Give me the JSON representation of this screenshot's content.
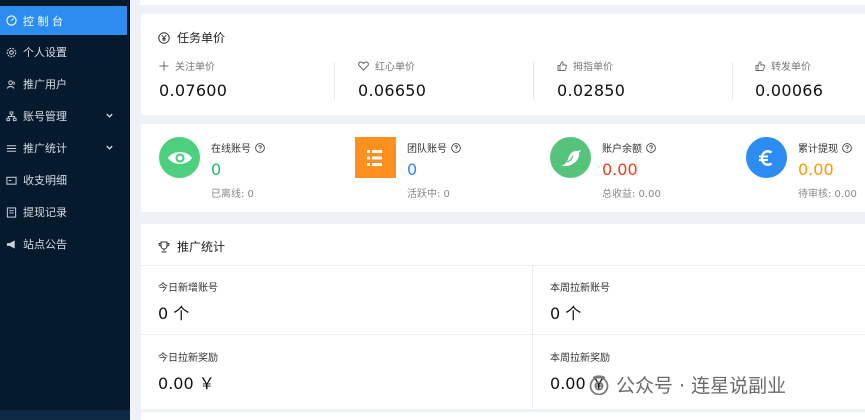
{
  "sidebar": {
    "items": [
      {
        "label": "控 制 台",
        "icon": "dashboard-icon"
      },
      {
        "label": "个人设置",
        "icon": "gear-icon"
      },
      {
        "label": "推广用户",
        "icon": "users-icon"
      },
      {
        "label": "账号管理",
        "icon": "sitemap-icon"
      },
      {
        "label": "推广统计",
        "icon": "list-icon"
      },
      {
        "label": "收支明细",
        "icon": "wallet-icon"
      },
      {
        "label": "提现记录",
        "icon": "document-icon"
      },
      {
        "label": "站点公告",
        "icon": "megaphone-icon"
      }
    ]
  },
  "price_card": {
    "title": "任务单价",
    "items": [
      {
        "label": "关注单价",
        "value": "0.07600",
        "icon": "plus-icon"
      },
      {
        "label": "红心单价",
        "value": "0.06650",
        "icon": "heart-icon"
      },
      {
        "label": "拇指单价",
        "value": "0.02850",
        "icon": "thumbs-up-icon"
      },
      {
        "label": "转发单价",
        "value": "0.00066",
        "icon": "thumbs-up-icon"
      }
    ]
  },
  "stats": [
    {
      "label": "在线账号",
      "value": "0",
      "sub": "已离线: 0",
      "color": "#19be6b",
      "icon": "eye-icon"
    },
    {
      "label": "团队账号",
      "value": "0",
      "sub": "活跃中: 0",
      "color": "#ff9900",
      "icon": "list-icon"
    },
    {
      "label": "账户余额",
      "value": "0.00",
      "sub": "总收益: 0.00",
      "color": "#ed4014",
      "icon": "bird-icon"
    },
    {
      "label": "累计提现",
      "value": "0.00",
      "sub": "待审核: 0.00",
      "color": "#ff9900",
      "icon": "euro-icon"
    }
  ],
  "stat_badge_colors": [
    "#4cd07d",
    "#ff8f1f",
    "#55c47a",
    "#2d8cf0"
  ],
  "stat_value_colors": [
    "#19be6b",
    "#2d8cf0",
    "#ed4014",
    "#ff9900"
  ],
  "promo_card": {
    "title": "推广统计",
    "cells": [
      {
        "label": "今日新增账号",
        "value": "0 个"
      },
      {
        "label": "本周拉新账号",
        "value": "0 个"
      },
      {
        "label": "今日拉新奖励",
        "value": "0.00 ￥"
      },
      {
        "label": "本周拉新奖励",
        "value": "0.00 ￥"
      }
    ]
  },
  "watermark": {
    "text": "公众号 · 连星说副业"
  }
}
